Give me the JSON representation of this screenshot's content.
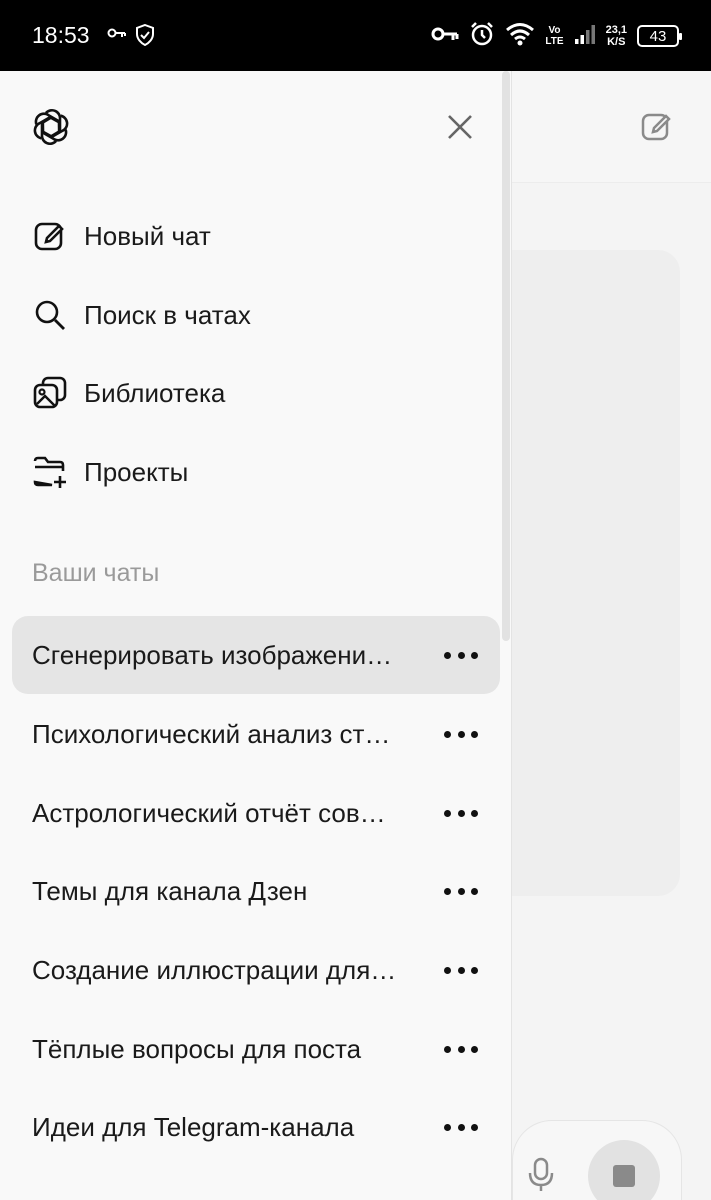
{
  "status_bar": {
    "time": "18:53",
    "speed_value": "23,1",
    "speed_unit": "K/S",
    "volte_top": "Vo",
    "volte_bottom": "LTE",
    "battery": "43"
  },
  "drawer": {
    "menu": [
      {
        "label": "Новый чат",
        "icon": "edit-icon"
      },
      {
        "label": "Поиск в чатах",
        "icon": "search-icon"
      },
      {
        "label": "Библиотека",
        "icon": "images-icon"
      },
      {
        "label": "Проекты",
        "icon": "folder-plus-icon"
      }
    ],
    "section_label": "Ваши чаты",
    "chats": [
      {
        "title": "Сгенерировать изображени…",
        "active": true
      },
      {
        "title": "Психологический анализ ст…"
      },
      {
        "title": "Астрологический отчёт сов…"
      },
      {
        "title": "Темы для канала Дзен"
      },
      {
        "title": "Создание иллюстрации для…"
      },
      {
        "title": "Тёплые вопросы для поста"
      },
      {
        "title": "Идеи для Telegram-канала"
      }
    ]
  }
}
